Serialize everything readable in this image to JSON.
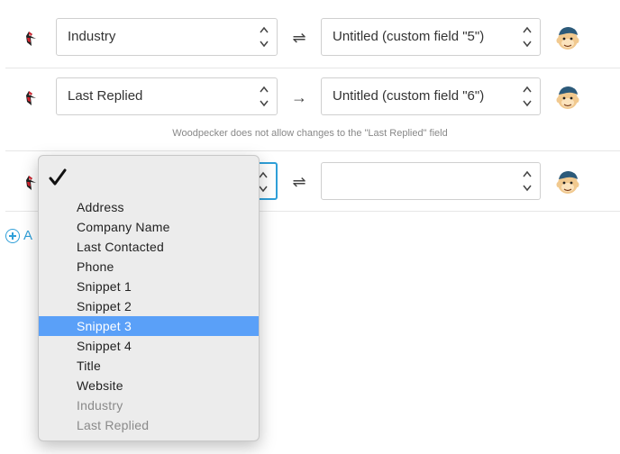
{
  "rows": [
    {
      "left_field": "Industry",
      "direction": "⇌",
      "right_field": "Untitled (custom field \"5\")"
    },
    {
      "left_field": "Last Replied",
      "direction": "→",
      "right_field": "Untitled (custom field \"6\")",
      "note": "Woodpecker does not allow changes to the \"Last Replied\" field"
    },
    {
      "left_field": "",
      "direction": "⇌",
      "right_field": ""
    }
  ],
  "add_link": {
    "label": "A"
  },
  "dropdown": {
    "checked_item": "",
    "items": [
      {
        "label": "Address",
        "state": "normal"
      },
      {
        "label": "Company Name",
        "state": "normal"
      },
      {
        "label": "Last Contacted",
        "state": "normal"
      },
      {
        "label": "Phone",
        "state": "normal"
      },
      {
        "label": "Snippet 1",
        "state": "normal"
      },
      {
        "label": "Snippet 2",
        "state": "normal"
      },
      {
        "label": "Snippet 3",
        "state": "selected"
      },
      {
        "label": "Snippet 4",
        "state": "normal"
      },
      {
        "label": "Title",
        "state": "normal"
      },
      {
        "label": "Website",
        "state": "normal"
      },
      {
        "label": "Industry",
        "state": "disabled"
      },
      {
        "label": "Last Replied",
        "state": "disabled"
      }
    ]
  },
  "icons": {
    "left": "woodpecker-icon",
    "right": "mailchimp-icon"
  },
  "colors": {
    "accent": "#2f9fd8",
    "highlight": "#5aa0f8"
  }
}
